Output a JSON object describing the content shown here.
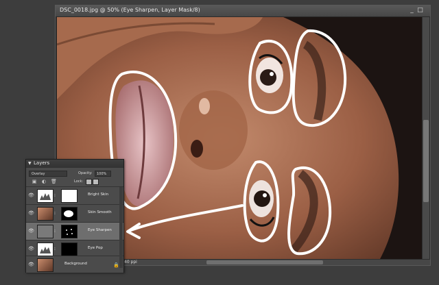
{
  "document": {
    "title": "DSC_0018.jpg @ 50% (Eye Sharpen, Layer Mask/8)",
    "zoom": "40 ppi"
  },
  "layers_panel": {
    "title": "Layers",
    "blend_mode": "Overlay",
    "opacity_label": "Opacity:",
    "opacity_value": "100%",
    "lock_label": "Lock:",
    "layers": [
      {
        "name": "Bright Skin",
        "thumb": "levels-icon",
        "mask": "white",
        "selected": false
      },
      {
        "name": "Skin Smooth",
        "thumb": "photo",
        "mask": "black-white",
        "selected": false
      },
      {
        "name": "Eye Sharpen",
        "thumb": "gray",
        "mask": "black-dots",
        "selected": true
      },
      {
        "name": "Eye Pop",
        "thumb": "levels-icon",
        "mask": "black",
        "selected": false
      },
      {
        "name": "Background",
        "thumb": "photo",
        "mask": "",
        "selected": false
      }
    ]
  },
  "colors": {
    "accent_annotation": "#ffffff",
    "panel_bg": "#4b4b4b",
    "selected_row": "#6e6e6e"
  }
}
